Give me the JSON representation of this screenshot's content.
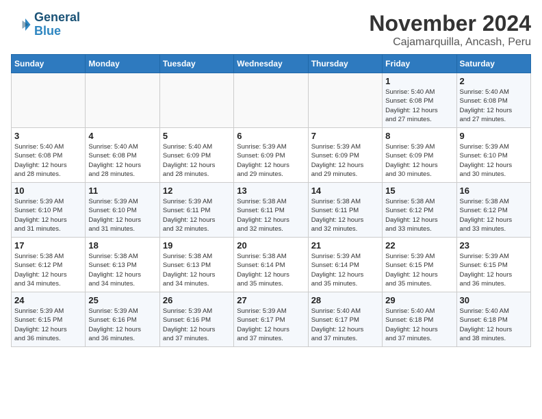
{
  "logo": {
    "line1": "General",
    "line2": "Blue"
  },
  "title": "November 2024",
  "subtitle": "Cajamarquilla, Ancash, Peru",
  "days_of_week": [
    "Sunday",
    "Monday",
    "Tuesday",
    "Wednesday",
    "Thursday",
    "Friday",
    "Saturday"
  ],
  "weeks": [
    [
      {
        "day": "",
        "info": ""
      },
      {
        "day": "",
        "info": ""
      },
      {
        "day": "",
        "info": ""
      },
      {
        "day": "",
        "info": ""
      },
      {
        "day": "",
        "info": ""
      },
      {
        "day": "1",
        "info": "Sunrise: 5:40 AM\nSunset: 6:08 PM\nDaylight: 12 hours\nand 27 minutes."
      },
      {
        "day": "2",
        "info": "Sunrise: 5:40 AM\nSunset: 6:08 PM\nDaylight: 12 hours\nand 27 minutes."
      }
    ],
    [
      {
        "day": "3",
        "info": "Sunrise: 5:40 AM\nSunset: 6:08 PM\nDaylight: 12 hours\nand 28 minutes."
      },
      {
        "day": "4",
        "info": "Sunrise: 5:40 AM\nSunset: 6:08 PM\nDaylight: 12 hours\nand 28 minutes."
      },
      {
        "day": "5",
        "info": "Sunrise: 5:40 AM\nSunset: 6:09 PM\nDaylight: 12 hours\nand 28 minutes."
      },
      {
        "day": "6",
        "info": "Sunrise: 5:39 AM\nSunset: 6:09 PM\nDaylight: 12 hours\nand 29 minutes."
      },
      {
        "day": "7",
        "info": "Sunrise: 5:39 AM\nSunset: 6:09 PM\nDaylight: 12 hours\nand 29 minutes."
      },
      {
        "day": "8",
        "info": "Sunrise: 5:39 AM\nSunset: 6:09 PM\nDaylight: 12 hours\nand 30 minutes."
      },
      {
        "day": "9",
        "info": "Sunrise: 5:39 AM\nSunset: 6:10 PM\nDaylight: 12 hours\nand 30 minutes."
      }
    ],
    [
      {
        "day": "10",
        "info": "Sunrise: 5:39 AM\nSunset: 6:10 PM\nDaylight: 12 hours\nand 31 minutes."
      },
      {
        "day": "11",
        "info": "Sunrise: 5:39 AM\nSunset: 6:10 PM\nDaylight: 12 hours\nand 31 minutes."
      },
      {
        "day": "12",
        "info": "Sunrise: 5:39 AM\nSunset: 6:11 PM\nDaylight: 12 hours\nand 32 minutes."
      },
      {
        "day": "13",
        "info": "Sunrise: 5:38 AM\nSunset: 6:11 PM\nDaylight: 12 hours\nand 32 minutes."
      },
      {
        "day": "14",
        "info": "Sunrise: 5:38 AM\nSunset: 6:11 PM\nDaylight: 12 hours\nand 32 minutes."
      },
      {
        "day": "15",
        "info": "Sunrise: 5:38 AM\nSunset: 6:12 PM\nDaylight: 12 hours\nand 33 minutes."
      },
      {
        "day": "16",
        "info": "Sunrise: 5:38 AM\nSunset: 6:12 PM\nDaylight: 12 hours\nand 33 minutes."
      }
    ],
    [
      {
        "day": "17",
        "info": "Sunrise: 5:38 AM\nSunset: 6:12 PM\nDaylight: 12 hours\nand 34 minutes."
      },
      {
        "day": "18",
        "info": "Sunrise: 5:38 AM\nSunset: 6:13 PM\nDaylight: 12 hours\nand 34 minutes."
      },
      {
        "day": "19",
        "info": "Sunrise: 5:38 AM\nSunset: 6:13 PM\nDaylight: 12 hours\nand 34 minutes."
      },
      {
        "day": "20",
        "info": "Sunrise: 5:38 AM\nSunset: 6:14 PM\nDaylight: 12 hours\nand 35 minutes."
      },
      {
        "day": "21",
        "info": "Sunrise: 5:39 AM\nSunset: 6:14 PM\nDaylight: 12 hours\nand 35 minutes."
      },
      {
        "day": "22",
        "info": "Sunrise: 5:39 AM\nSunset: 6:15 PM\nDaylight: 12 hours\nand 35 minutes."
      },
      {
        "day": "23",
        "info": "Sunrise: 5:39 AM\nSunset: 6:15 PM\nDaylight: 12 hours\nand 36 minutes."
      }
    ],
    [
      {
        "day": "24",
        "info": "Sunrise: 5:39 AM\nSunset: 6:15 PM\nDaylight: 12 hours\nand 36 minutes."
      },
      {
        "day": "25",
        "info": "Sunrise: 5:39 AM\nSunset: 6:16 PM\nDaylight: 12 hours\nand 36 minutes."
      },
      {
        "day": "26",
        "info": "Sunrise: 5:39 AM\nSunset: 6:16 PM\nDaylight: 12 hours\nand 37 minutes."
      },
      {
        "day": "27",
        "info": "Sunrise: 5:39 AM\nSunset: 6:17 PM\nDaylight: 12 hours\nand 37 minutes."
      },
      {
        "day": "28",
        "info": "Sunrise: 5:40 AM\nSunset: 6:17 PM\nDaylight: 12 hours\nand 37 minutes."
      },
      {
        "day": "29",
        "info": "Sunrise: 5:40 AM\nSunset: 6:18 PM\nDaylight: 12 hours\nand 37 minutes."
      },
      {
        "day": "30",
        "info": "Sunrise: 5:40 AM\nSunset: 6:18 PM\nDaylight: 12 hours\nand 38 minutes."
      }
    ]
  ]
}
